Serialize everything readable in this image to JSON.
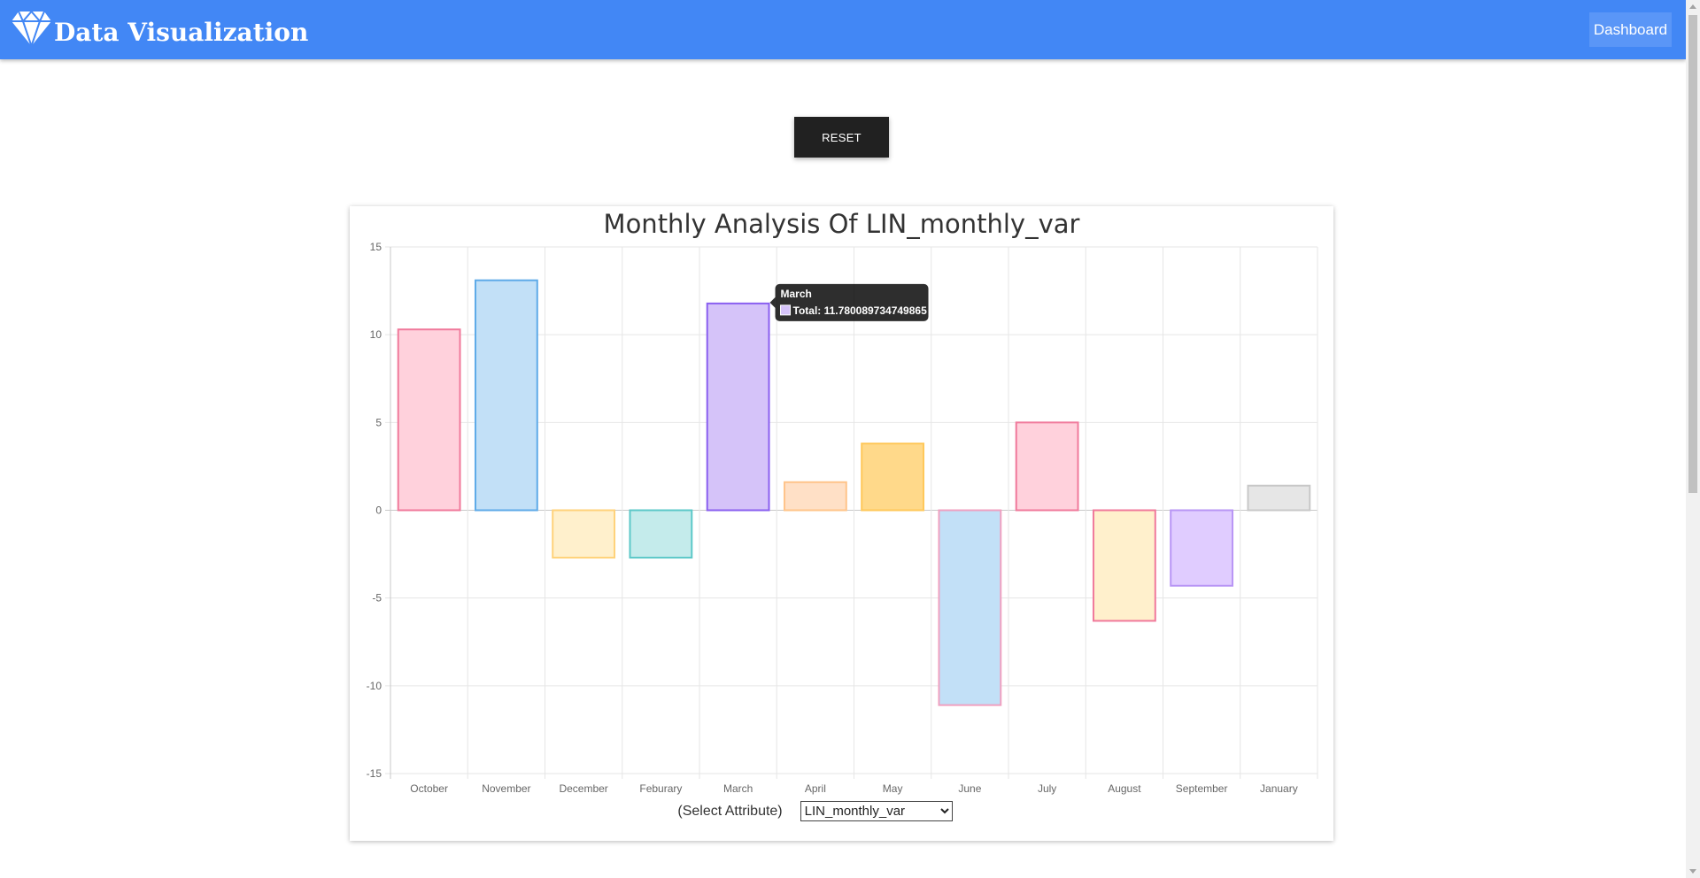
{
  "header": {
    "brand_text": "Data Visualization",
    "brand_icon": "diamond-icon",
    "nav_dashboard": "Dashboard"
  },
  "controls": {
    "reset_label": "RESET",
    "attribute_label": "(Select Attribute)",
    "attribute_selected": "LIN_monthly_var"
  },
  "tooltip": {
    "title": "March",
    "text": "Total: 11.780089734749865"
  },
  "chart_data": {
    "type": "bar",
    "title": "Monthly Analysis Of LIN_monthly_var",
    "categories": [
      "October",
      "November",
      "December",
      "Feburary",
      "March",
      "April",
      "May",
      "June",
      "July",
      "August",
      "September",
      "January"
    ],
    "series": [
      {
        "values": [
          10.3,
          13.1,
          -2.7,
          -2.7,
          11.780089734749865,
          1.6,
          3.8,
          -11.1,
          5.0,
          -6.3,
          -4.3,
          1.4
        ]
      }
    ],
    "ylim": [
      -15,
      15
    ],
    "yticks": [
      15,
      10,
      5,
      0,
      -5,
      -10,
      -15
    ],
    "grid": true,
    "highlighted": "March",
    "colors": {
      "fills": [
        "#ffd1dc",
        "#c2e0f7",
        "#fff0cc",
        "#c4ebeb",
        "#d5c3f9",
        "#ffe0c6",
        "#ffd98a",
        "#c2e0f7",
        "#ffd1dc",
        "#fff0cc",
        "#e0ccff",
        "#e6e6e6"
      ],
      "borders": [
        "#f0799b",
        "#5eaae8",
        "#ffd27a",
        "#5cc8c8",
        "#8a5ff0",
        "#ffc48a",
        "#ffc85a",
        "#f0a0c0",
        "#f0799b",
        "#f0799b",
        "#b895f5",
        "#c8c8c8"
      ]
    }
  }
}
